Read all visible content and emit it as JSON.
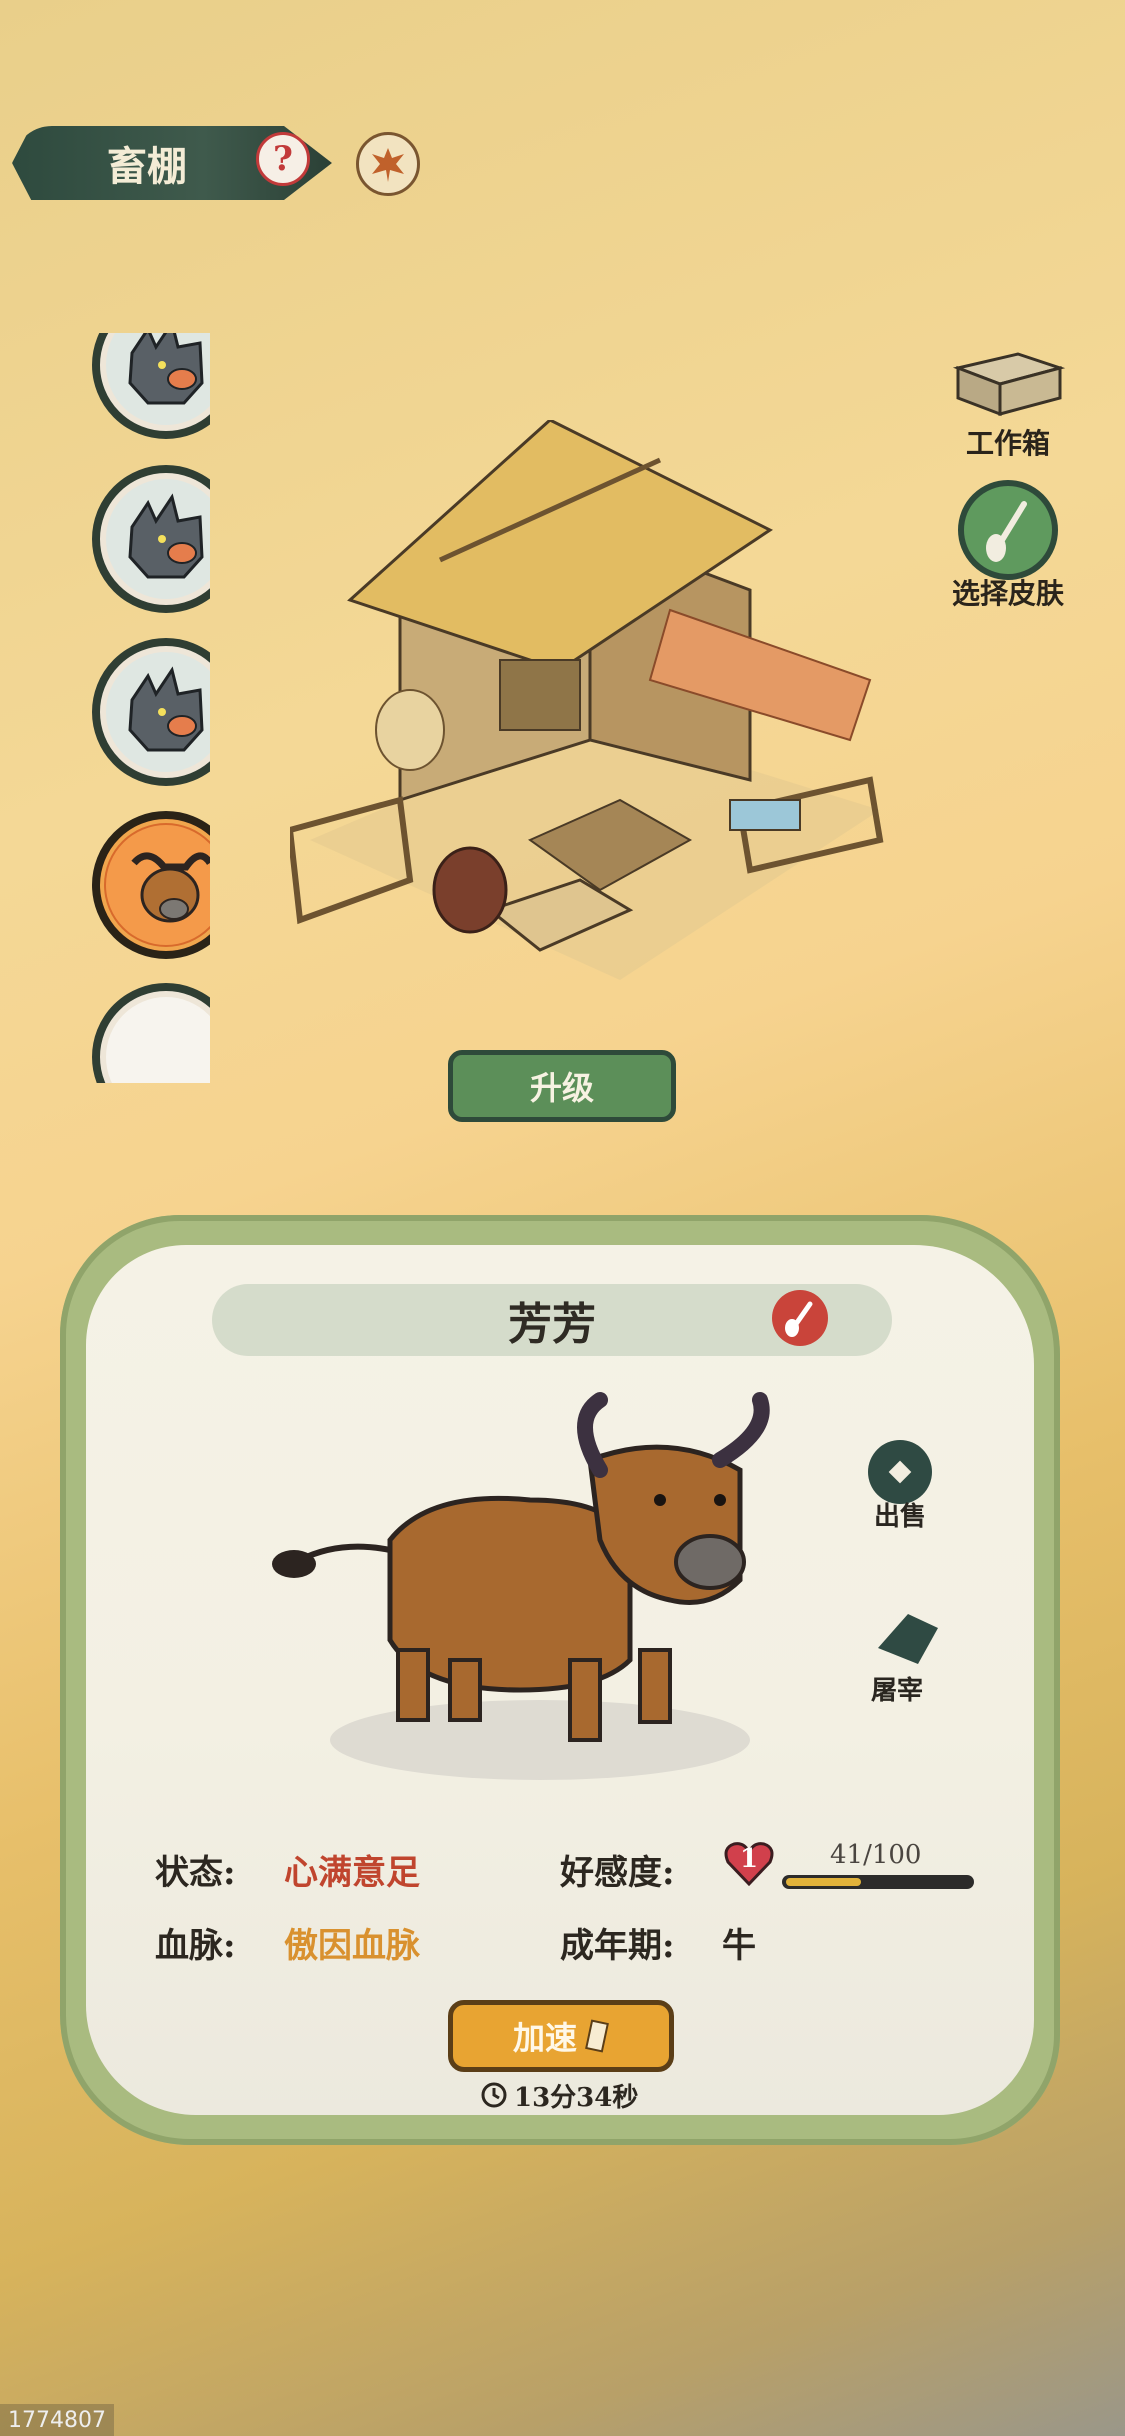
{
  "header": {
    "title": "畜棚"
  },
  "tools": {
    "workbox_label": "工作箱",
    "skin_label": "选择皮肤"
  },
  "upgrade_label": "升级",
  "avatars": [
    {
      "animal": "boar"
    },
    {
      "animal": "boar"
    },
    {
      "animal": "boar"
    },
    {
      "animal": "ox",
      "selected": true
    },
    {
      "animal": "empty"
    }
  ],
  "animal": {
    "name": "芳芳",
    "actions": {
      "sell": "出售",
      "slaughter": "屠宰"
    },
    "stats": {
      "status_label": "状态:",
      "status_value": "心满意足",
      "bloodline_label": "血脉:",
      "bloodline_value": "傲因血脉",
      "affection_label": "好感度:",
      "affection_level": "1",
      "affection_progress": "41/100",
      "affection_fraction": 0.41,
      "adult_label": "成年期:",
      "adult_value": "牛"
    },
    "speedup_label": "加速",
    "timer": "13分34秒"
  },
  "watermark": "1774807",
  "colors": {
    "accent_green": "#5c8f59",
    "status_red": "#c0452e",
    "bloodline_orange": "#d9912f",
    "speed_orange": "#e8a432"
  }
}
